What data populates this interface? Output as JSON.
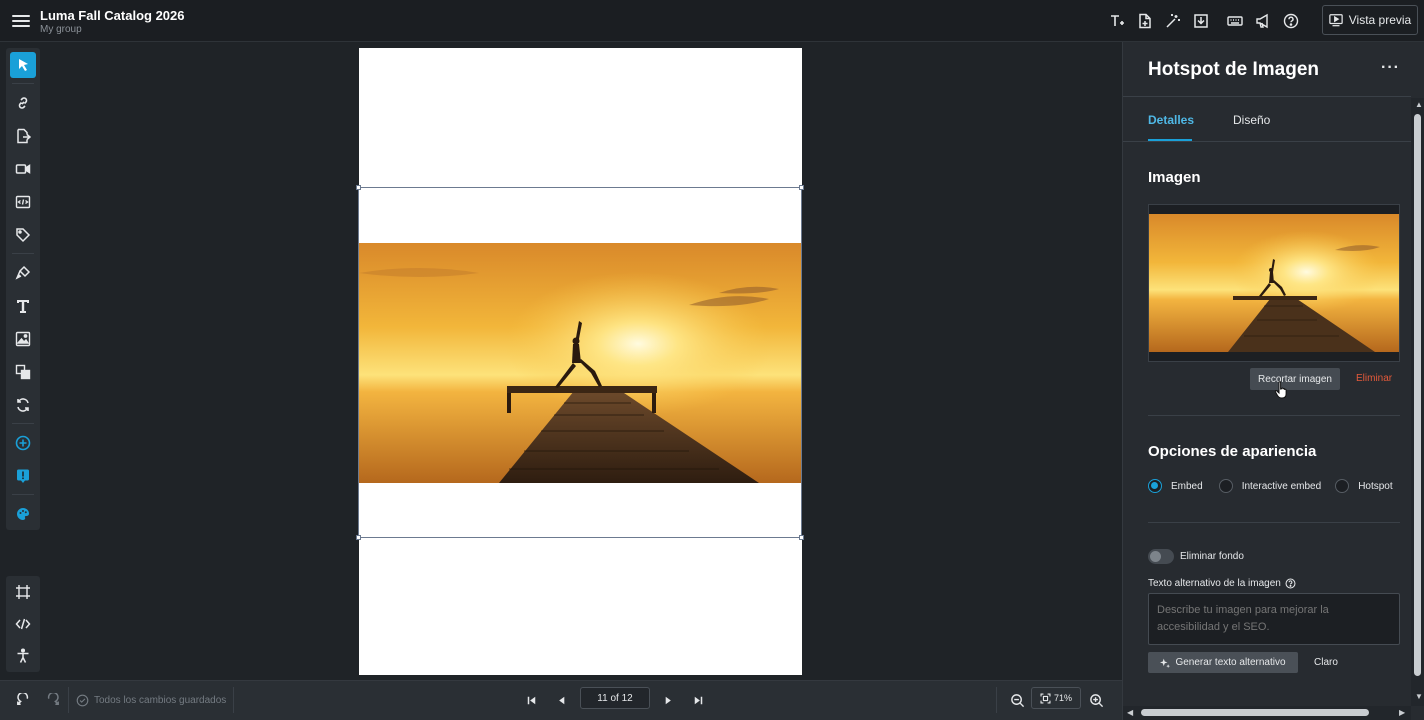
{
  "header": {
    "title": "Luma Fall Catalog 2026",
    "group": "My group",
    "preview_label": "Vista previa"
  },
  "editor": {
    "saved_status": "Todos los cambios guardados",
    "page_indicator": "11 of 12",
    "zoom": "71%"
  },
  "panel": {
    "title": "Hotspot de Imagen",
    "more": "···",
    "tabs": [
      {
        "label": "Detalles",
        "active": true
      },
      {
        "label": "Diseño",
        "active": false
      }
    ],
    "image_section": "Imagen",
    "crop_label": "Recortar imagen",
    "delete_label": "Eliminar",
    "appearance_section": "Opciones de apariencia",
    "appearance_options": [
      {
        "label": "Embed",
        "selected": true
      },
      {
        "label": "Interactive embed",
        "selected": false
      },
      {
        "label": "Hotspot",
        "selected": false
      }
    ],
    "remove_bg_label": "Eliminar fondo",
    "remove_bg_on": false,
    "alt_label": "Texto alternativo de la imagen",
    "alt_placeholder": "Describe tu imagen para mejorar la accesibilidad y el SEO.",
    "alt_value": "",
    "generate_label": "Generar texto alternativo",
    "clear_label": "Claro"
  },
  "icons": {
    "top": [
      "text-plus-icon",
      "add-file-icon",
      "magic-wand-icon",
      "download-icon",
      "keyboard-icon",
      "megaphone-icon",
      "help-icon"
    ],
    "toolbar": [
      "pointer-icon",
      "link-icon",
      "page-link-icon",
      "video-icon",
      "embed-code-icon",
      "tag-icon",
      "pen-icon",
      "text-icon",
      "image-icon",
      "layers-icon",
      "refresh-icon",
      "add-circle-icon",
      "info-badge-icon",
      "palette-icon"
    ],
    "toolbar_bottom": [
      "frame-icon",
      "code-icon",
      "accessibility-icon"
    ]
  },
  "colors": {
    "accent": "#1aa0d8",
    "delete": "#e35a3a",
    "panel_bg": "#272b30",
    "canvas_bg": "#1f2327"
  }
}
